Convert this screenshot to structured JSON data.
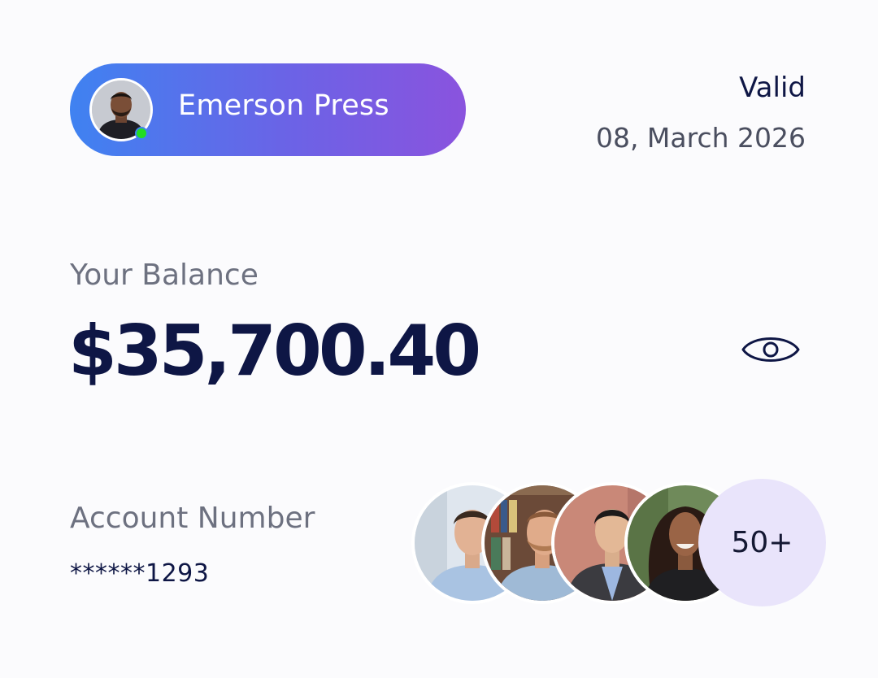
{
  "profile": {
    "name": "Emerson Press",
    "avatar_icon": "user-avatar",
    "status": "online",
    "status_color": "#22dd22",
    "gradient_start": "#3f82f1",
    "gradient_end": "#8a53de"
  },
  "validity": {
    "label": "Valid",
    "date": "08, March 2026"
  },
  "balance": {
    "label": "Your Balance",
    "amount": "$35,700.40",
    "visibility_icon": "eye-icon"
  },
  "account": {
    "label": "Account Number",
    "number": "******1293"
  },
  "members": {
    "avatars": [
      "member-avatar-1",
      "member-avatar-2",
      "member-avatar-3",
      "member-avatar-4"
    ],
    "more_label": "50+"
  },
  "colors": {
    "primary_text": "#0e1645",
    "secondary_text": "#6d7180",
    "badge_bg": "#e9e4fb"
  }
}
